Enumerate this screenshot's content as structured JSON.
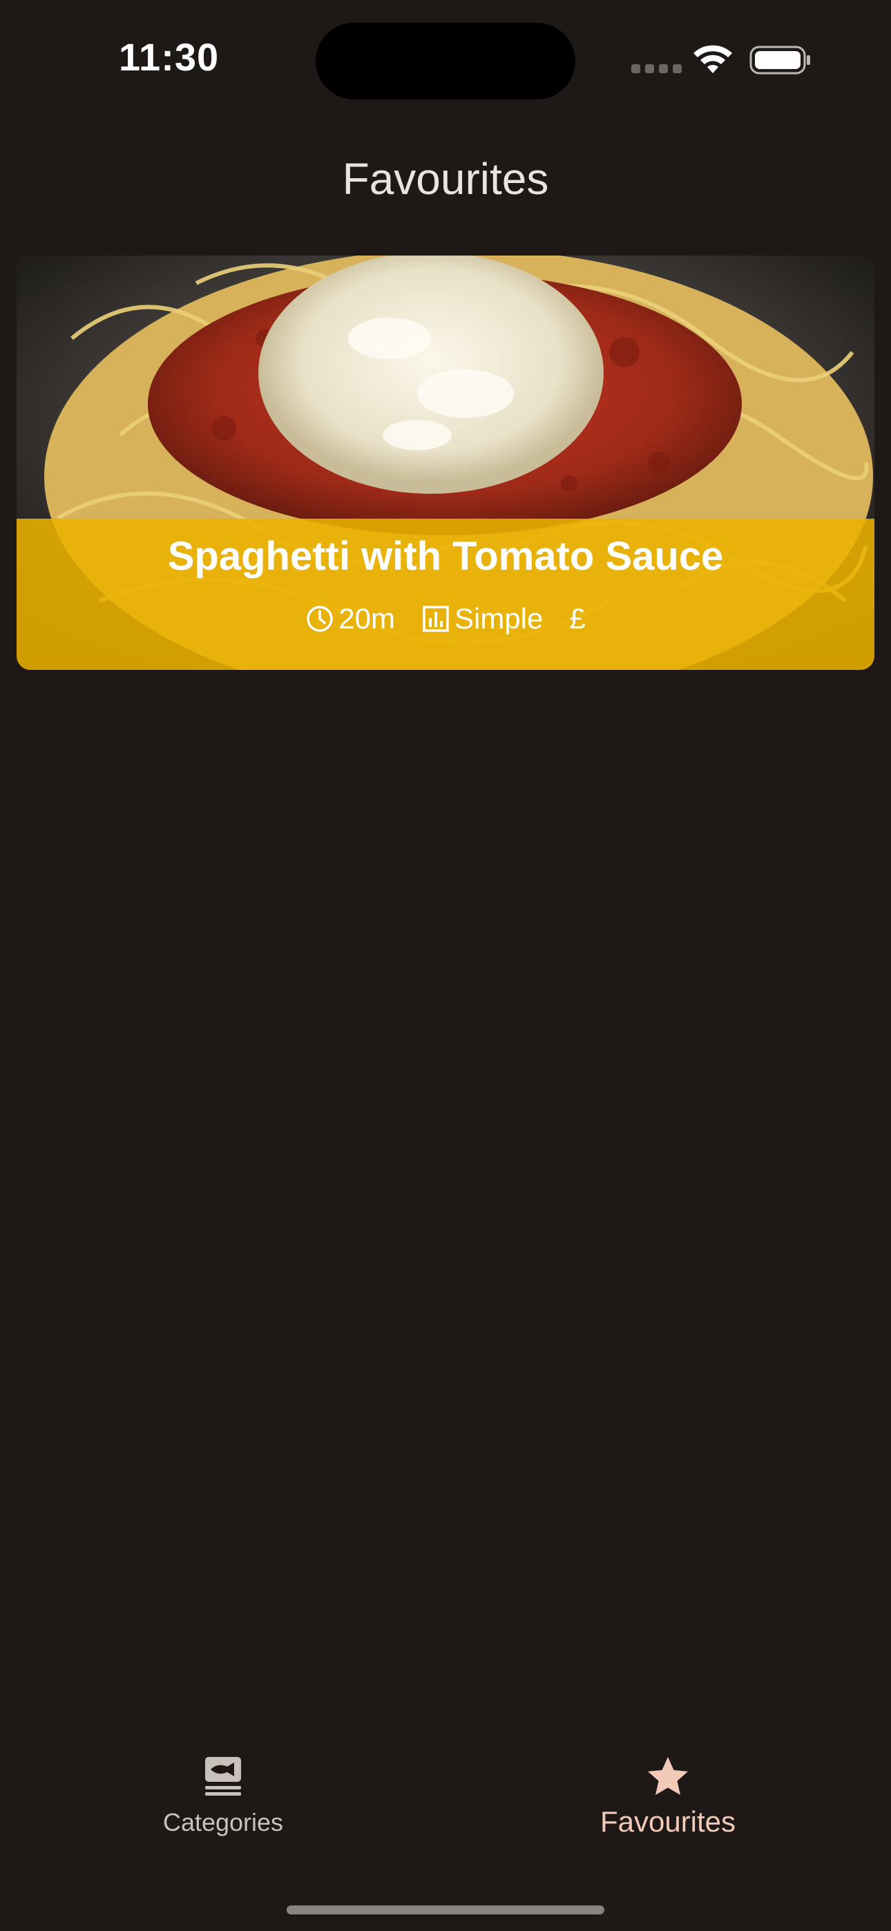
{
  "status_bar": {
    "time": "11:30",
    "icons": [
      "cellular-signal-icon",
      "wifi-icon",
      "battery-icon"
    ]
  },
  "header": {
    "title": "Favourites"
  },
  "meals": [
    {
      "title": "Spaghetti with Tomato Sauce",
      "duration": "20m",
      "complexity": "Simple",
      "affordability": "£",
      "icons": [
        "clock-icon",
        "bar-chart-icon"
      ]
    }
  ],
  "tab_bar": {
    "items": [
      {
        "label": "Categories",
        "icon": "set-meal-icon",
        "selected": false
      },
      {
        "label": "Favourites",
        "icon": "star-icon",
        "selected": true
      }
    ]
  },
  "colors": {
    "background": "#1e1916",
    "card_overlay": "#ebb200",
    "selected_tab": "#f3c9b7",
    "unselected_tab": "#c9c1bb"
  }
}
